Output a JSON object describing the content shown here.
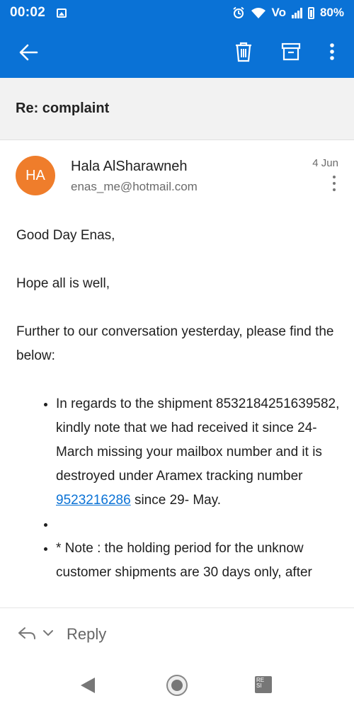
{
  "status_bar": {
    "time": "00:02",
    "network_label": "Vo",
    "battery": "80%"
  },
  "app_bar": {
    "back_icon": "arrow-left-icon",
    "actions": [
      "trash-icon",
      "archive-icon",
      "more-vert-icon"
    ],
    "accent_color": "#0a72d6"
  },
  "subject": "Re: complaint",
  "message": {
    "avatar_initials": "HA",
    "avatar_color": "#ef7d2b",
    "sender_name": "Hala AlSharawneh",
    "sender_email": "enas_me@hotmail.com",
    "date": "4 Jun",
    "greeting": "Good Day Enas,",
    "line2": "Hope all is well,",
    "line3": "Further to our conversation yesterday, please find the below:",
    "bullet1_prefix": "In regards to the shipment 8532184251639582, kindly note that we had received it since 24- March missing your mailbox number and it is destroyed under Aramex tracking number ",
    "bullet1_link": "9523216286",
    "bullet1_suffix": " since 29- May.",
    "bullet2": "",
    "bullet3": "* Note : the holding period for the unknow customer shipments are 30 days only, after"
  },
  "reply_bar": {
    "label": "Reply"
  },
  "nav_bar": {
    "recent_label": "RE SI"
  }
}
